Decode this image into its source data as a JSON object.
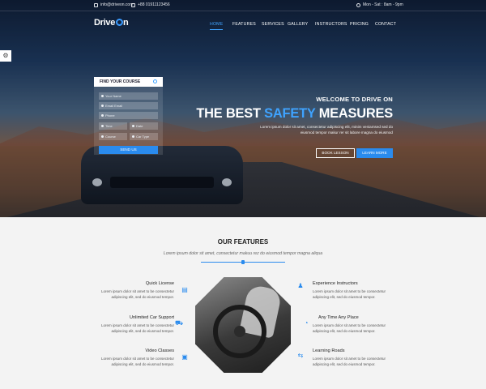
{
  "topbar": {
    "email": "info@driveon.com",
    "phone": "+88 01911123456",
    "hours": "Mon - Sat : 8am - 9pm"
  },
  "brand": {
    "part1": "Drive",
    "part2": "n"
  },
  "nav": {
    "items": [
      "HOME",
      "FEATURES",
      "SERVICES",
      "GALLERY",
      "INSTRUCTORS",
      "PRICING",
      "CONTACT"
    ],
    "active": "HOME"
  },
  "form": {
    "title": "FIND YOUR COURSE",
    "fields": {
      "name": "Your Name",
      "email": "Email Email",
      "phone": "Phone",
      "time": "Time",
      "date": "Date",
      "course": "Course",
      "car_type": "Car Type"
    },
    "submit": "SEND US"
  },
  "hero": {
    "welcome": "WELCOME TO DRIVE ON",
    "headline_pre": "THE BEST ",
    "headline_accent": "SAFETY",
    "headline_post": " MEASURES",
    "desc_line1": "Lorem ipsum dolor sit amet, consectetur adipiscing elit, minim veniamsed sed do",
    "desc_line2": "eiusmod tempor makur rer sit labore magna do eiusmod",
    "btn_book": "BOOK LESSON",
    "btn_learn": "LEARN MORE"
  },
  "features": {
    "title": "OUR FEATURES",
    "subtitle": "Lorem ipsum dolor sit amet, consectetur makuu rez do eiusmod tempor magna aliqua",
    "items": [
      {
        "title": "Quick License",
        "desc1": "Lorem ipsum dolor sit amet to be consectetur",
        "desc2": "adipiscing elit, sed do eiusmod tempor.",
        "icon": "document-icon"
      },
      {
        "title": "Unlimited Car Support",
        "desc1": "Lorem ipsum dolor sit amet to be consectetur",
        "desc2": "adipiscing elit, sed do eiusmod tempor.",
        "icon": "car-icon"
      },
      {
        "title": "Video Classes",
        "desc1": "Lorem ipsum dolor sit amet to be consectetur",
        "desc2": "adipiscing elit, sed do eiusmod tempor.",
        "icon": "video-icon"
      },
      {
        "title": "Experience Instructors",
        "desc1": "Lorem ipsum dolor sit amet to be consectetur",
        "desc2": "adipiscing elit, sed do eiusmod tempor.",
        "icon": "instructor-icon"
      },
      {
        "title": "Any Time Any Place",
        "desc1": "Lorem ipsum dolor sit amet to be consectetur",
        "desc2": "adipiscing elit, sed do eiusmod tempor.",
        "icon": "clock-icon"
      },
      {
        "title": "Learning Roads",
        "desc1": "Lorem ipsum dolor sit amet to be consectetur",
        "desc2": "adipiscing elit, sed do eiusmod tempor.",
        "icon": "road-sign-icon"
      }
    ]
  },
  "colors": {
    "accent": "#2a8bee",
    "accent_light": "#3fa3ff",
    "page_bg": "#f3f3f3"
  }
}
